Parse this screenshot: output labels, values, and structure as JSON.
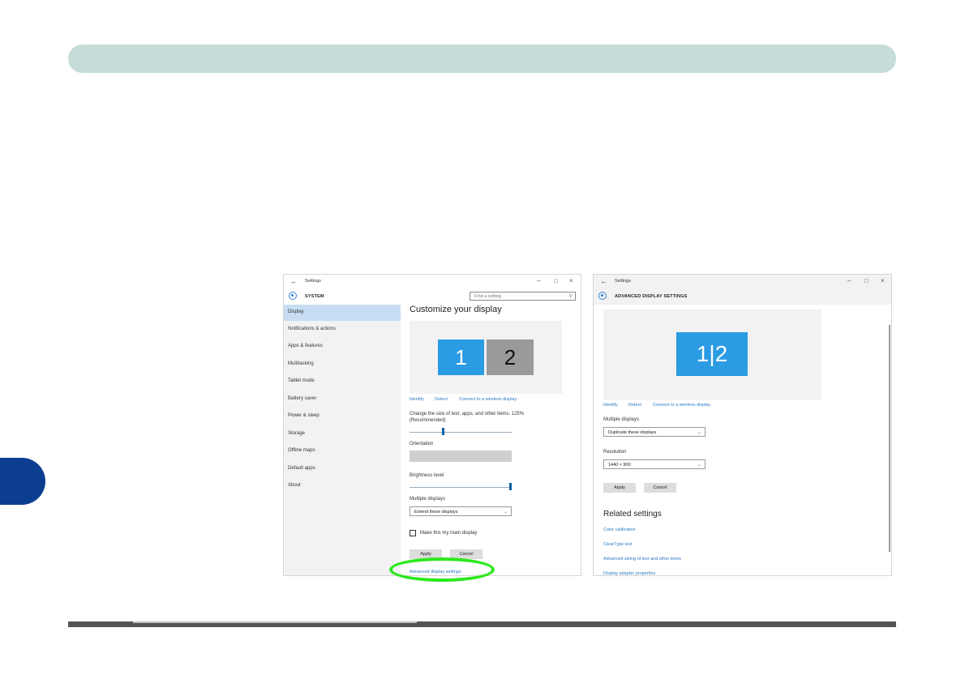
{
  "colors": {
    "accent": "#2b9be3",
    "header_band": "#c5dcd9",
    "side_tab": "#0b3d91",
    "highlight_oval": "#2de81d",
    "link": "#2b79c2"
  },
  "settings_window": {
    "title": "Settings",
    "section": "SYSTEM",
    "search_placeholder": "Find a setting",
    "sidebar": [
      "Display",
      "Notifications & actions",
      "Apps & features",
      "Multitasking",
      "Tablet mode",
      "Battery saver",
      "Power & sleep",
      "Storage",
      "Offline maps",
      "Default apps",
      "About"
    ],
    "heading": "Customize your display",
    "monitors": [
      "1",
      "2"
    ],
    "links": [
      "Identify",
      "Detect",
      "Connect to a wireless display"
    ],
    "scale_label": "Change the size of text, apps, and other items: 125% (Recommended)",
    "orientation_label": "Orientation",
    "brightness_label": "Brightness level",
    "multiple_displays_label": "Multiple displays",
    "multiple_displays_value": "Extend these displays",
    "main_display_label": "Make this my main display",
    "apply": "Apply",
    "cancel": "Cancel",
    "advanced_link": "Advanced display settings"
  },
  "advanced_window": {
    "title": "Settings",
    "section": "ADVANCED DISPLAY SETTINGS",
    "monitor": "1|2",
    "links": [
      "Identify",
      "Detect",
      "Connect to a wireless display"
    ],
    "multiple_displays_label": "Multiple displays",
    "multiple_displays_value": "Duplicate these displays",
    "resolution_label": "Resolution",
    "resolution_value": "1440 × 900",
    "apply": "Apply",
    "cancel": "Cancel",
    "related_heading": "Related settings",
    "related_links": [
      "Color calibration",
      "ClearType text",
      "Advanced sizing of text and other items",
      "Display adapter properties"
    ]
  }
}
